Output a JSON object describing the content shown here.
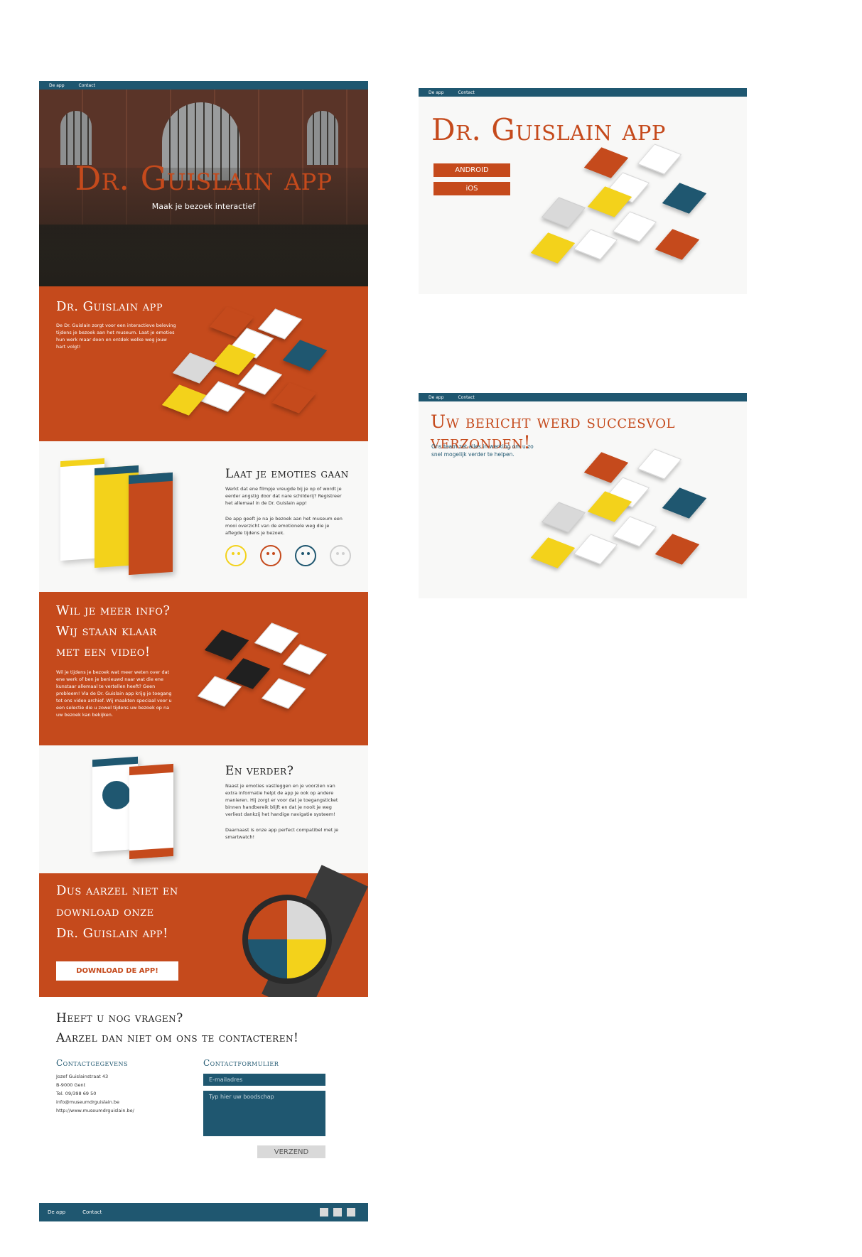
{
  "nav": {
    "item_app": "De app",
    "item_contact": "Contact"
  },
  "hero": {
    "title": "Dr. Guislain app",
    "subtitle": "Maak je bezoek interactief"
  },
  "intro": {
    "title": "Dr. Guislain app",
    "text": "De Dr. Guislain zorgt voor een interactieve beleving tijdens je bezoek aan het museum. Laat je emoties hun werk maar doen en ontdek welke weg jouw hart volgt!"
  },
  "emotions": {
    "title": "Laat je emoties gaan",
    "text1": "Werkt dat ene filmpje vreugde bij je op of wordt je eerder angstig door dat nare schilderij? Registreer het allemaal in de Dr. Guislain app!",
    "text2": "De app geeft je na je bezoek aan het museum een mooi overzicht van de emotionele weg die je aflegde tijdens je bezoek.",
    "faces": [
      "happy-face-icon",
      "angry-face-icon",
      "sad-face-icon",
      "scared-face-icon"
    ]
  },
  "video": {
    "title_line1": "Wil je meer info?",
    "title_line2": "Wij staan klaar",
    "title_line3": "met een video!",
    "text": "Wil je tijdens je bezoek wat meer weten over dat ene werk of ben je benieuwd naar wat die ene kunstaar allemaal te vertellen heeft? Geen probleem! Via de Dr. Guislain app krijg je toegang tot ons video archief. Wij maakten speciaal voor u een selectie die u zowel tijdens uw bezoek op na uw bezoek kan bekijken."
  },
  "further": {
    "title": "En verder?",
    "text1": "Naast je emoties vastleggen en je voorzien van extra informatie helpt de app je ook op andere manieren. Hij zorgt er voor dat je toegangsticket binnen handbereik blijft en dat je nooit je weg verliest dankzij het handige navigatie systeem!",
    "text2": "Daarnaast is onze app perfect compatibel met je smartwatch!"
  },
  "download": {
    "line1": "Dus aarzel niet en",
    "line2": "download onze",
    "line3": "Dr. Guislain app!",
    "button": "DOWNLOAD DE APP!"
  },
  "contact": {
    "heading1": "Heeft u nog vragen?",
    "heading2": "Aarzel dan niet om ons te contacteren!",
    "details_title": "Contactgegevens",
    "address1": "Jozef Guislainstraat 43",
    "address2": "B-9000 Gent",
    "phone": "Tel. 09/398 69 50",
    "email": "info@museumdrguislain.be",
    "website": "http://www.museumdrguislain.be/",
    "form_title": "Contactformulier",
    "email_placeholder": "E-mailadres",
    "message_placeholder": "Typ hier uw boodschap",
    "submit": "VERZEND"
  },
  "landing": {
    "title": "Dr. Guislain app",
    "android": "ANDROID",
    "ios": "iOS"
  },
  "success": {
    "title": "Uw bericht werd succesvol verzonden!",
    "text": "Ons team zet alles in werking om u zo snel mogelijk verder te helpen."
  },
  "colors": {
    "orange": "#c54a1c",
    "blue": "#1f5770",
    "yellow": "#f3d21b",
    "light": "#f8f8f7"
  }
}
